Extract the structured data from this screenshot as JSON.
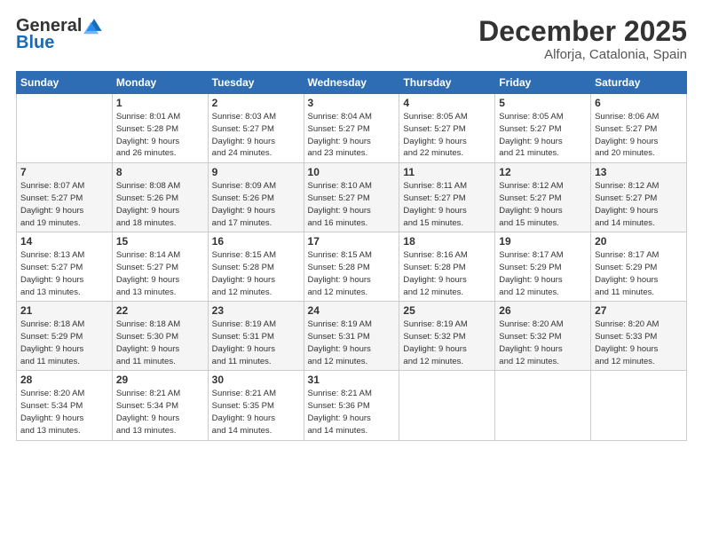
{
  "header": {
    "logo_line1": "General",
    "logo_line2": "Blue",
    "month": "December 2025",
    "location": "Alforja, Catalonia, Spain"
  },
  "weekdays": [
    "Sunday",
    "Monday",
    "Tuesday",
    "Wednesday",
    "Thursday",
    "Friday",
    "Saturday"
  ],
  "weeks": [
    [
      {
        "day": "",
        "info": ""
      },
      {
        "day": "1",
        "info": "Sunrise: 8:01 AM\nSunset: 5:28 PM\nDaylight: 9 hours\nand 26 minutes."
      },
      {
        "day": "2",
        "info": "Sunrise: 8:03 AM\nSunset: 5:27 PM\nDaylight: 9 hours\nand 24 minutes."
      },
      {
        "day": "3",
        "info": "Sunrise: 8:04 AM\nSunset: 5:27 PM\nDaylight: 9 hours\nand 23 minutes."
      },
      {
        "day": "4",
        "info": "Sunrise: 8:05 AM\nSunset: 5:27 PM\nDaylight: 9 hours\nand 22 minutes."
      },
      {
        "day": "5",
        "info": "Sunrise: 8:05 AM\nSunset: 5:27 PM\nDaylight: 9 hours\nand 21 minutes."
      },
      {
        "day": "6",
        "info": "Sunrise: 8:06 AM\nSunset: 5:27 PM\nDaylight: 9 hours\nand 20 minutes."
      }
    ],
    [
      {
        "day": "7",
        "info": "Sunrise: 8:07 AM\nSunset: 5:27 PM\nDaylight: 9 hours\nand 19 minutes."
      },
      {
        "day": "8",
        "info": "Sunrise: 8:08 AM\nSunset: 5:26 PM\nDaylight: 9 hours\nand 18 minutes."
      },
      {
        "day": "9",
        "info": "Sunrise: 8:09 AM\nSunset: 5:26 PM\nDaylight: 9 hours\nand 17 minutes."
      },
      {
        "day": "10",
        "info": "Sunrise: 8:10 AM\nSunset: 5:27 PM\nDaylight: 9 hours\nand 16 minutes."
      },
      {
        "day": "11",
        "info": "Sunrise: 8:11 AM\nSunset: 5:27 PM\nDaylight: 9 hours\nand 15 minutes."
      },
      {
        "day": "12",
        "info": "Sunrise: 8:12 AM\nSunset: 5:27 PM\nDaylight: 9 hours\nand 15 minutes."
      },
      {
        "day": "13",
        "info": "Sunrise: 8:12 AM\nSunset: 5:27 PM\nDaylight: 9 hours\nand 14 minutes."
      }
    ],
    [
      {
        "day": "14",
        "info": "Sunrise: 8:13 AM\nSunset: 5:27 PM\nDaylight: 9 hours\nand 13 minutes."
      },
      {
        "day": "15",
        "info": "Sunrise: 8:14 AM\nSunset: 5:27 PM\nDaylight: 9 hours\nand 13 minutes."
      },
      {
        "day": "16",
        "info": "Sunrise: 8:15 AM\nSunset: 5:28 PM\nDaylight: 9 hours\nand 12 minutes."
      },
      {
        "day": "17",
        "info": "Sunrise: 8:15 AM\nSunset: 5:28 PM\nDaylight: 9 hours\nand 12 minutes."
      },
      {
        "day": "18",
        "info": "Sunrise: 8:16 AM\nSunset: 5:28 PM\nDaylight: 9 hours\nand 12 minutes."
      },
      {
        "day": "19",
        "info": "Sunrise: 8:17 AM\nSunset: 5:29 PM\nDaylight: 9 hours\nand 12 minutes."
      },
      {
        "day": "20",
        "info": "Sunrise: 8:17 AM\nSunset: 5:29 PM\nDaylight: 9 hours\nand 11 minutes."
      }
    ],
    [
      {
        "day": "21",
        "info": "Sunrise: 8:18 AM\nSunset: 5:29 PM\nDaylight: 9 hours\nand 11 minutes."
      },
      {
        "day": "22",
        "info": "Sunrise: 8:18 AM\nSunset: 5:30 PM\nDaylight: 9 hours\nand 11 minutes."
      },
      {
        "day": "23",
        "info": "Sunrise: 8:19 AM\nSunset: 5:31 PM\nDaylight: 9 hours\nand 11 minutes."
      },
      {
        "day": "24",
        "info": "Sunrise: 8:19 AM\nSunset: 5:31 PM\nDaylight: 9 hours\nand 12 minutes."
      },
      {
        "day": "25",
        "info": "Sunrise: 8:19 AM\nSunset: 5:32 PM\nDaylight: 9 hours\nand 12 minutes."
      },
      {
        "day": "26",
        "info": "Sunrise: 8:20 AM\nSunset: 5:32 PM\nDaylight: 9 hours\nand 12 minutes."
      },
      {
        "day": "27",
        "info": "Sunrise: 8:20 AM\nSunset: 5:33 PM\nDaylight: 9 hours\nand 12 minutes."
      }
    ],
    [
      {
        "day": "28",
        "info": "Sunrise: 8:20 AM\nSunset: 5:34 PM\nDaylight: 9 hours\nand 13 minutes."
      },
      {
        "day": "29",
        "info": "Sunrise: 8:21 AM\nSunset: 5:34 PM\nDaylight: 9 hours\nand 13 minutes."
      },
      {
        "day": "30",
        "info": "Sunrise: 8:21 AM\nSunset: 5:35 PM\nDaylight: 9 hours\nand 14 minutes."
      },
      {
        "day": "31",
        "info": "Sunrise: 8:21 AM\nSunset: 5:36 PM\nDaylight: 9 hours\nand 14 minutes."
      },
      {
        "day": "",
        "info": ""
      },
      {
        "day": "",
        "info": ""
      },
      {
        "day": "",
        "info": ""
      }
    ]
  ]
}
